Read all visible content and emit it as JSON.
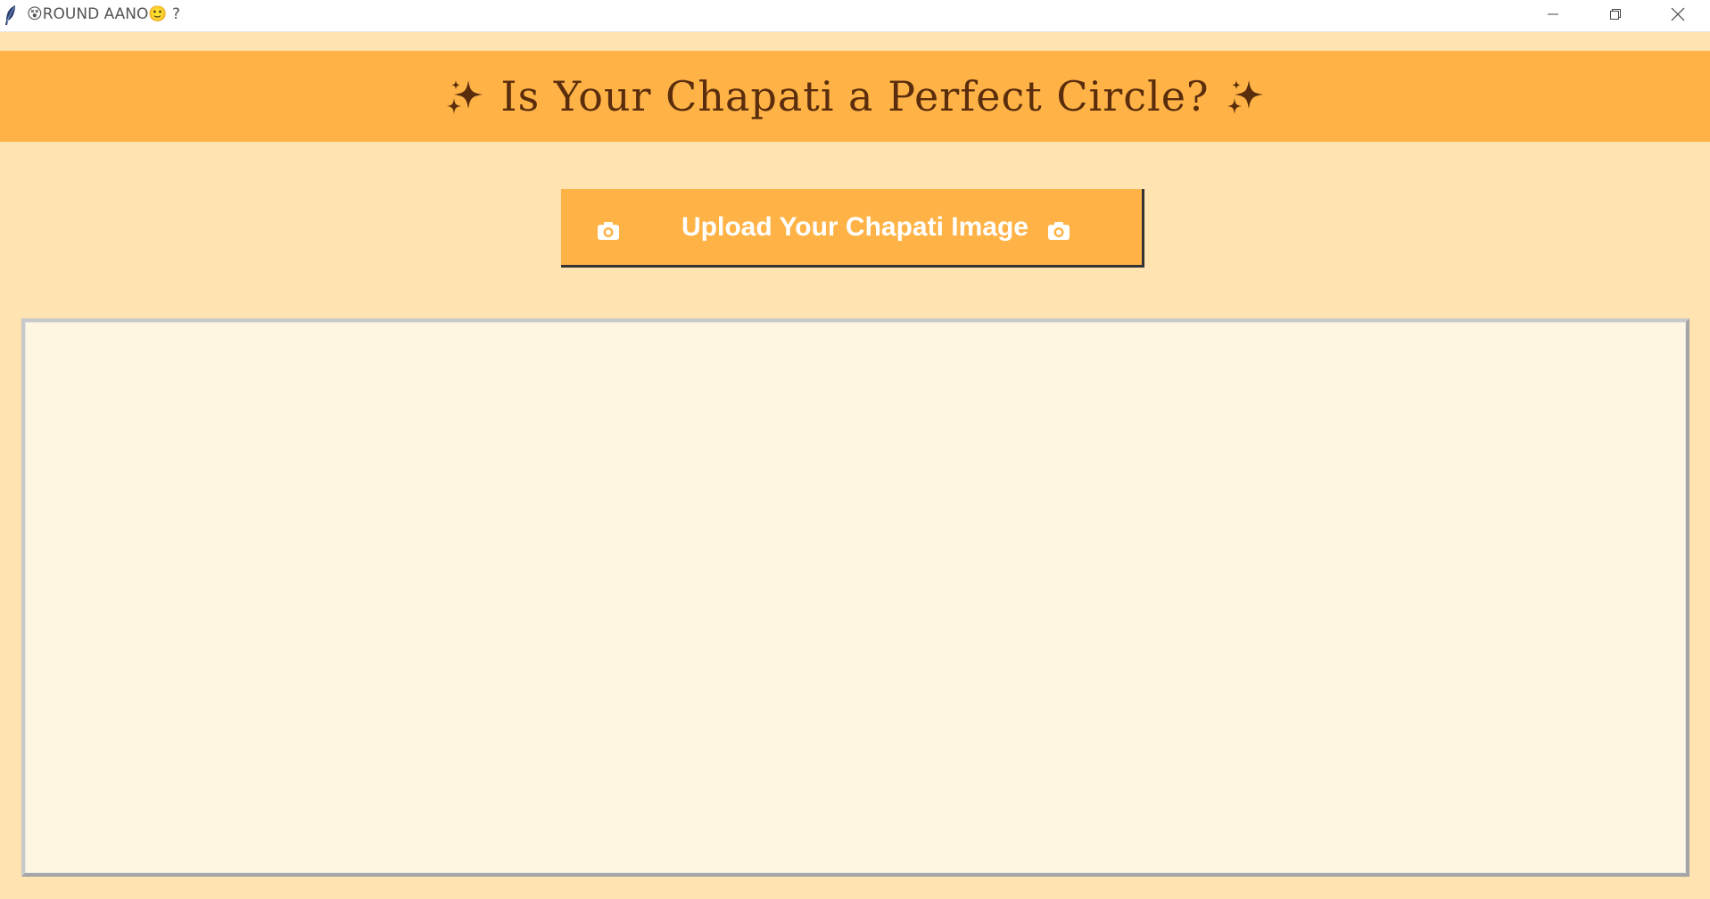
{
  "window": {
    "title": "😵ROUND AANO🙂 ?",
    "controls": {
      "minimize": "minimize-icon",
      "restore": "restore-icon",
      "close": "close-icon"
    }
  },
  "header": {
    "title": "Is Your Chapati a Perfect Circle?",
    "left_icon": "sparkle-icon",
    "right_icon": "sparkle-icon"
  },
  "upload": {
    "label": "Upload Your Chapati Image",
    "left_icon": "camera-icon",
    "right_icon": "camera-icon"
  },
  "colors": {
    "background": "#ffe3b0",
    "header": "#ffb347",
    "header_text": "#5a2d0c",
    "button": "#ffb347",
    "button_text": "#ffffff",
    "panel": "#fff6e2"
  }
}
